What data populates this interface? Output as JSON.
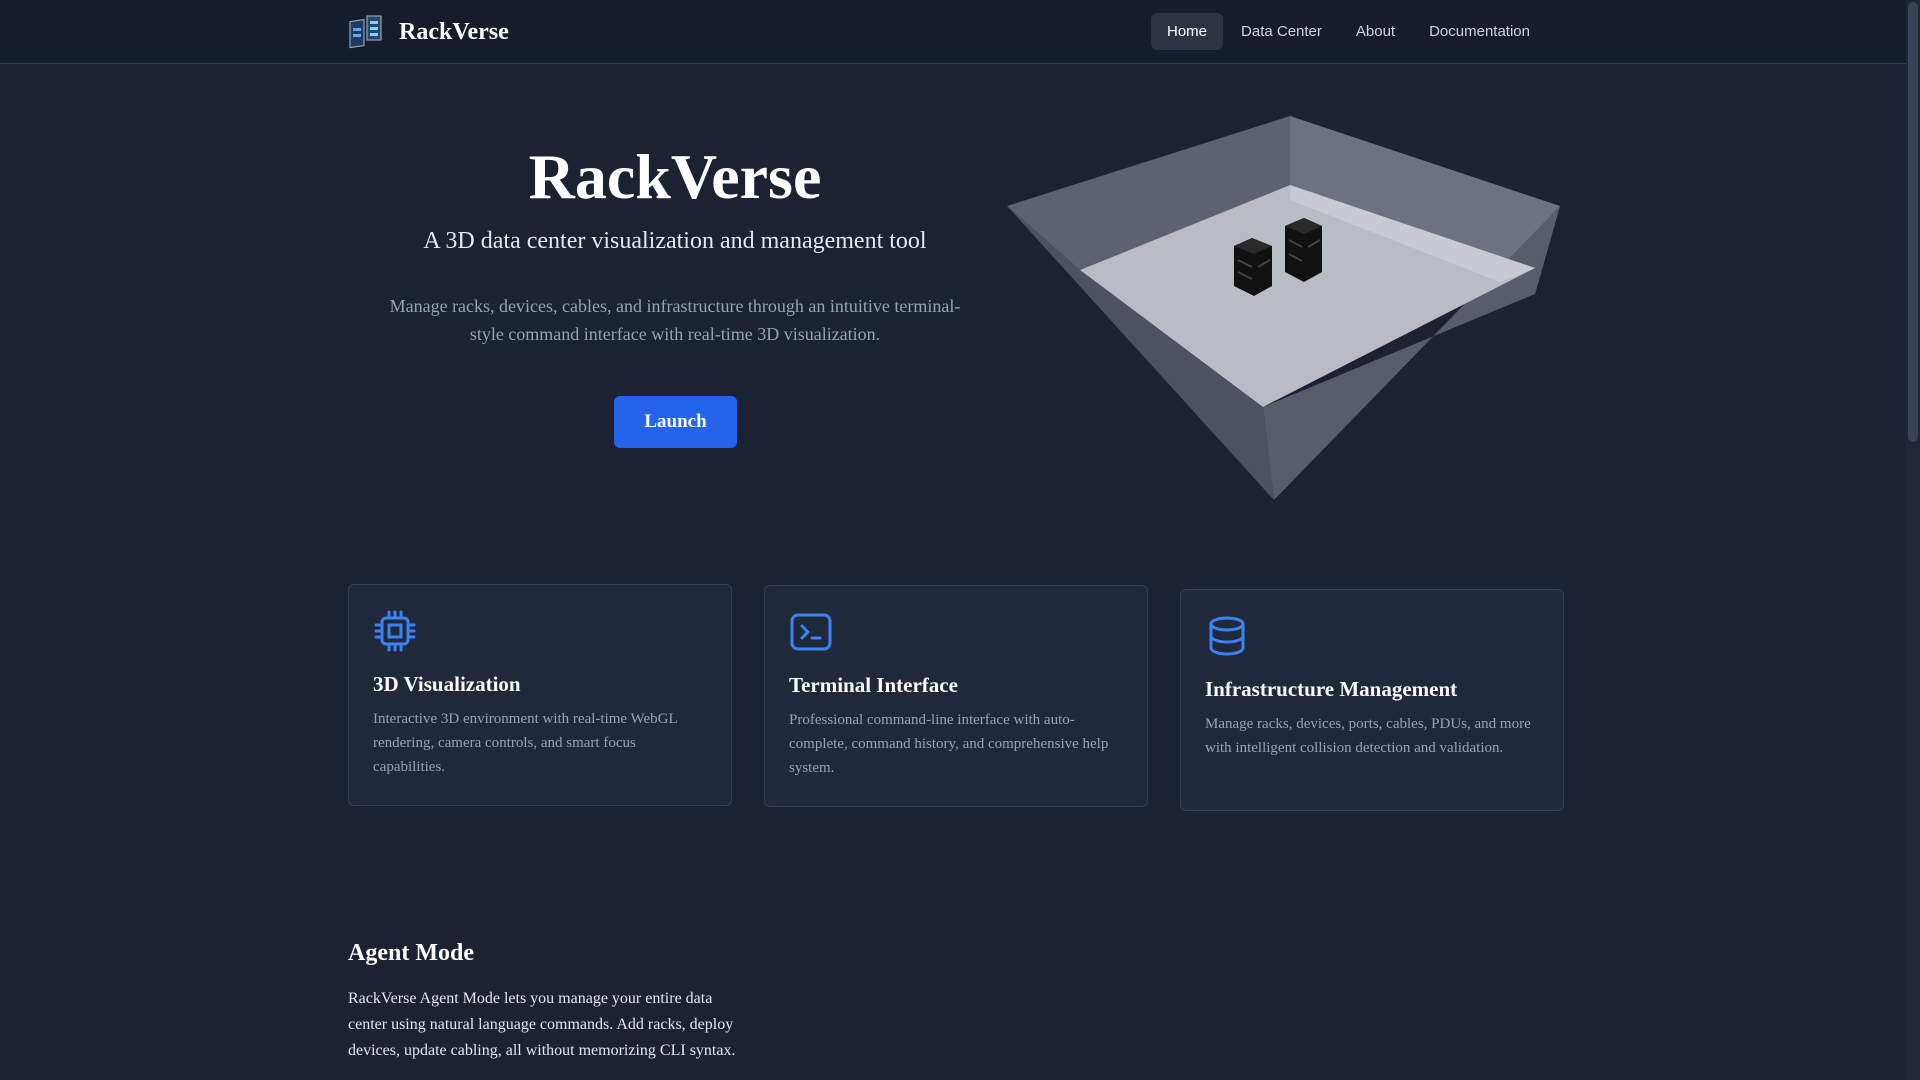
{
  "brand": {
    "name": "RackVerse",
    "logo_icon": "server-racks-icon"
  },
  "nav": {
    "items": [
      {
        "label": "Home",
        "active": true
      },
      {
        "label": "Data Center",
        "active": false
      },
      {
        "label": "About",
        "active": false
      },
      {
        "label": "Documentation",
        "active": false
      }
    ]
  },
  "hero": {
    "title": "RackVerse",
    "subtitle": "A 3D data center visualization and management tool",
    "description": "Manage racks, devices, cables, and infrastructure through an intuitive terminal-style command interface with real-time 3D visualization.",
    "launch_label": "Launch"
  },
  "features": [
    {
      "icon": "cpu-chip-icon",
      "title": "3D Visualization",
      "description": "Interactive 3D environment with real-time WebGL rendering, camera controls, and smart focus capabilities."
    },
    {
      "icon": "terminal-icon",
      "title": "Terminal Interface",
      "description": "Professional command-line interface with auto-complete, command history, and comprehensive help system."
    },
    {
      "icon": "database-icon",
      "title": "Infrastructure Management",
      "description": "Manage racks, devices, ports, cables, PDUs, and more with intelligent collision detection and validation."
    }
  ],
  "agent": {
    "title": "Agent Mode",
    "description": "RackVerse Agent Mode lets you manage your entire data center using natural language commands. Add racks, deploy devices, update cabling, all without memorizing CLI syntax."
  },
  "colors": {
    "background": "#1b2333",
    "header": "#151c2a",
    "accent": "#2563eb",
    "icon": "#3b82f6",
    "card": "#202939"
  }
}
